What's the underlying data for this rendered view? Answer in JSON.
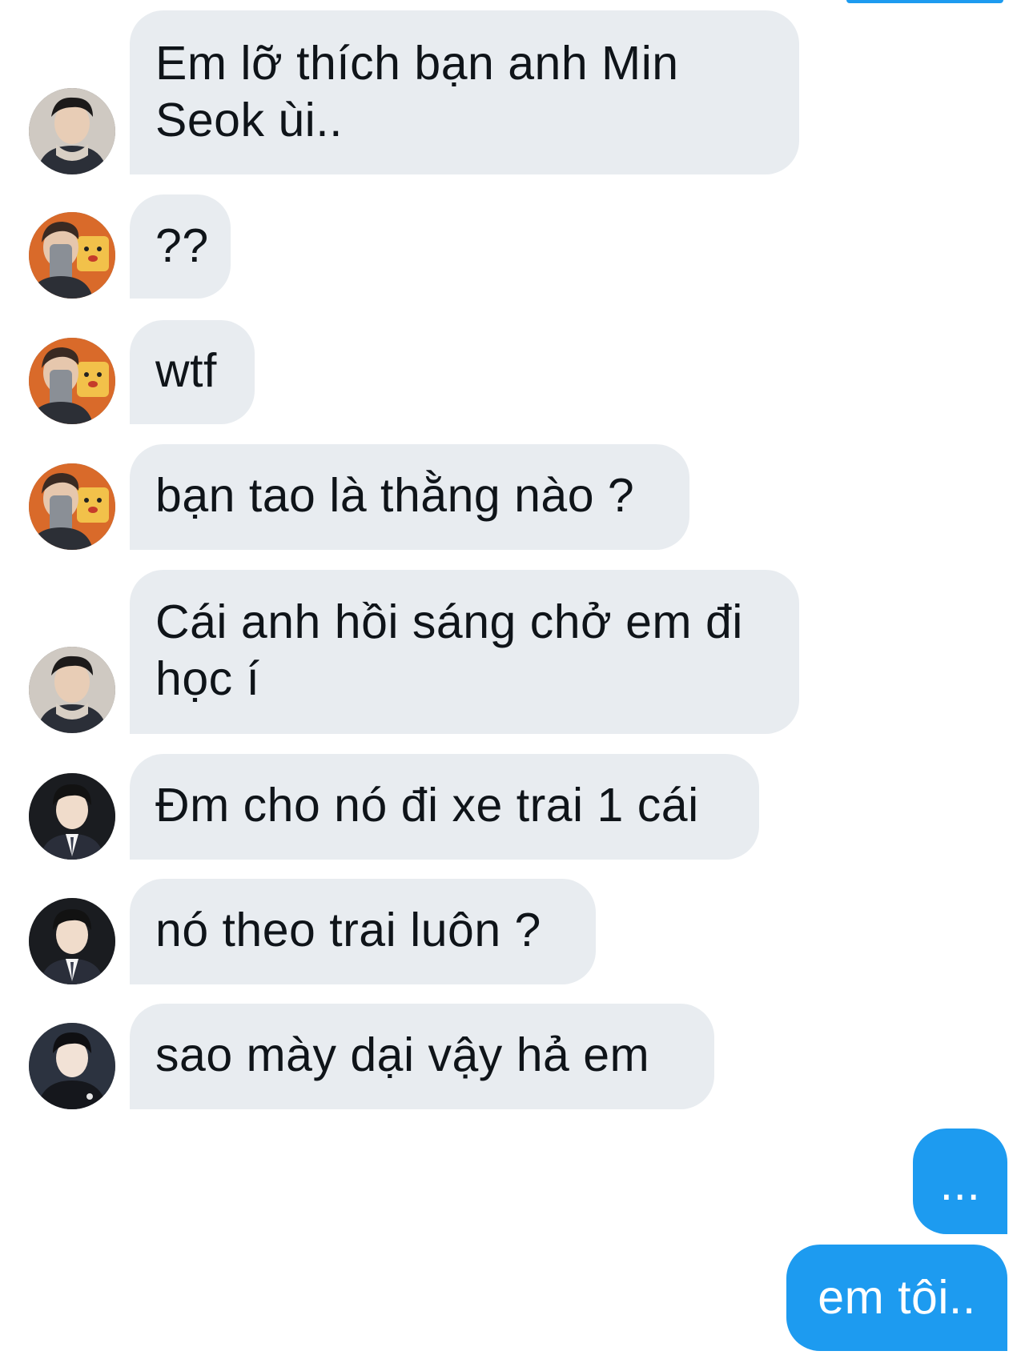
{
  "messages": [
    {
      "text": "Em lỡ thích bạn anh Min Seok ùi..",
      "lines": [
        "Em lỡ thích bạn anh Min",
        "Seok ùi.."
      ],
      "avatar": "avatar-boy-scarf"
    },
    {
      "text": "??",
      "lines": [
        "??"
      ],
      "avatar": "avatar-boy-phone"
    },
    {
      "text": "wtf",
      "lines": [
        "wtf"
      ],
      "avatar": "avatar-boy-phone"
    },
    {
      "text": "bạn tao là thằng nào ?",
      "lines": [
        "bạn tao là thằng nào ?"
      ],
      "avatar": "avatar-boy-phone"
    },
    {
      "text": "Cái anh hồi sáng chở em đi học í",
      "lines": [
        "Cái anh hồi sáng chở em đi",
        "học í"
      ],
      "avatar": "avatar-boy-scarf"
    },
    {
      "text": "Đm cho nó đi xe trai 1 cái",
      "lines": [
        "Đm cho nó đi xe trai 1 cái"
      ],
      "avatar": "avatar-boy-suit"
    },
    {
      "text": "nó theo trai luôn ?",
      "lines": [
        "nó theo trai luôn ?"
      ],
      "avatar": "avatar-boy-suit"
    },
    {
      "text": "sao mày dại vậy hả em",
      "lines": [
        "sao mày dại vậy hả em"
      ],
      "avatar": "avatar-boy-dark"
    }
  ],
  "outgoing": [
    {
      "text": "..."
    },
    {
      "text": "em tôi.."
    }
  ],
  "colors": {
    "incoming_bubble": "#e8ecf0",
    "outgoing_bubble": "#1d9bf0",
    "incoming_text": "#0f1419",
    "outgoing_text": "#ffffff"
  }
}
